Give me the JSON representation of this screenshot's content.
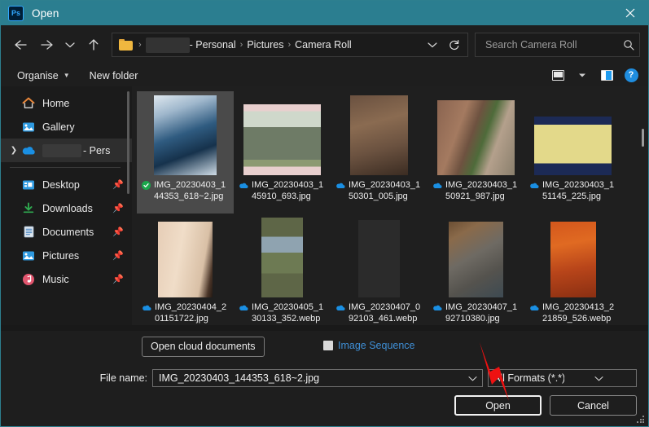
{
  "window": {
    "app_icon": "photoshop-icon",
    "app_icon_text": "Ps",
    "title": "Open",
    "close_label": "✕",
    "titlebar_color": "#2b7e90"
  },
  "navigation": {
    "back": "back-arrow",
    "forward": "forward-arrow",
    "recent": "chevron-down",
    "up": "up-arrow"
  },
  "address": {
    "folder_icon": "folder-icon",
    "crumbs": [
      "",
      "- Personal",
      "Pictures",
      "Camera Roll"
    ],
    "crumb_redacted": true,
    "dropdown": "chevron-down-icon",
    "refresh": "refresh-icon"
  },
  "search": {
    "placeholder": "Search Camera Roll",
    "value": "",
    "icon": "search-icon"
  },
  "commandbar": {
    "organise": "Organise",
    "new_folder": "New folder",
    "view_icon": "view-layout-icon",
    "view_caret": "chevron-down-icon",
    "preview_pane_icon": "preview-pane-icon",
    "help_icon": "help-icon",
    "help_label": "?"
  },
  "sidebar": {
    "items": [
      {
        "label": "Home",
        "icon": "home-icon",
        "pinned": false,
        "selected": false,
        "expandable": false,
        "redacted": false
      },
      {
        "label": "Gallery",
        "icon": "gallery-icon",
        "pinned": false,
        "selected": false,
        "expandable": false,
        "redacted": false
      },
      {
        "label": "- Pers",
        "icon": "onedrive-icon",
        "pinned": false,
        "selected": true,
        "expandable": true,
        "redacted": true
      },
      {
        "label": "Desktop",
        "icon": "desktop-icon",
        "pinned": true,
        "selected": false,
        "expandable": false,
        "redacted": false
      },
      {
        "label": "Downloads",
        "icon": "downloads-icon",
        "pinned": true,
        "selected": false,
        "expandable": false,
        "redacted": false
      },
      {
        "label": "Documents",
        "icon": "documents-icon",
        "pinned": true,
        "selected": false,
        "expandable": false,
        "redacted": false
      },
      {
        "label": "Pictures",
        "icon": "pictures-icon",
        "pinned": true,
        "selected": false,
        "expandable": false,
        "redacted": false
      },
      {
        "label": "Music",
        "icon": "music-icon",
        "pinned": true,
        "selected": false,
        "expandable": false,
        "redacted": false
      }
    ],
    "pin_glyph": "📌"
  },
  "files": [
    {
      "name": "IMG_20230403_144353_618~2.jpg",
      "status": "synced-local",
      "selected": true,
      "thumb": "sky-clouds"
    },
    {
      "name": "IMG_20230403_145910_693.jpg",
      "status": "cloud-only",
      "selected": false,
      "thumb": "painting-figures"
    },
    {
      "name": "IMG_20230403_150301_005.jpg",
      "status": "cloud-only",
      "selected": false,
      "thumb": "brown-garment"
    },
    {
      "name": "IMG_20230403_150921_987.jpg",
      "status": "cloud-only",
      "selected": false,
      "thumb": "window-stone-wall"
    },
    {
      "name": "IMG_20230403_151145_225.jpg",
      "status": "cloud-only",
      "selected": false,
      "thumb": "yellow-note-board"
    },
    {
      "name": "IMG_20230404_201151722.jpg",
      "status": "cloud-only",
      "selected": false,
      "thumb": "open-book"
    },
    {
      "name": "IMG_20230405_130133_352.webp",
      "status": "cloud-only",
      "selected": false,
      "thumb": "green-book-cover"
    },
    {
      "name": "IMG_20230407_092103_461.webp",
      "status": "cloud-only",
      "selected": false,
      "thumb": "dark-text-page"
    },
    {
      "name": "IMG_20230407_192710380.jpg",
      "status": "cloud-only",
      "selected": false,
      "thumb": "cat"
    },
    {
      "name": "IMG_20230413_221859_526.webp",
      "status": "cloud-only",
      "selected": false,
      "thumb": "orange-album-cover"
    }
  ],
  "footer": {
    "open_cloud_documents": "Open cloud documents",
    "image_sequence_label": "Image Sequence",
    "image_sequence_checked": false,
    "file_name_label": "File name:",
    "file_name_value": "IMG_20230403_144353_618~2.jpg",
    "format_value": "All Formats (*.*)",
    "open_button": "Open",
    "cancel_button": "Cancel",
    "resize_grip": "resize-grip"
  },
  "annotation": {
    "type": "red-arrow",
    "color": "#ee1111",
    "points_to": "Open"
  }
}
